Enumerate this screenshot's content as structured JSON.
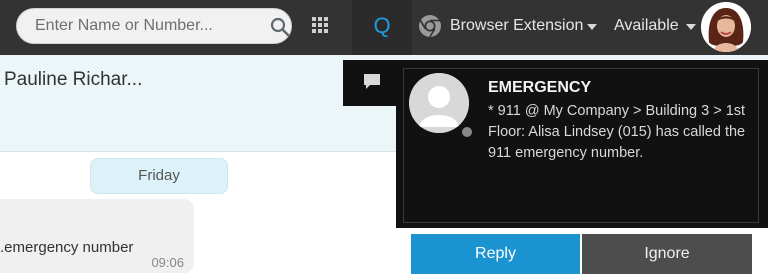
{
  "topbar": {
    "search": {
      "placeholder": "Enter Name or Number...",
      "icon": "search-icon"
    },
    "apps_icon": "grid-icon",
    "q_tab_label": "Q",
    "extension": {
      "label": "Browser Extension",
      "icon": "chrome-icon"
    },
    "status": {
      "label": "Available"
    },
    "colors": {
      "bar": "#333333",
      "accent": "#1e9be0"
    }
  },
  "chat": {
    "contact_name": "Pauline Richar...",
    "day_divider": "Friday",
    "message": {
      "text": "emergency number.",
      "time": "09:06"
    }
  },
  "notification": {
    "title": "EMERGENCY",
    "body": "* 911 @ My Company > Building 3 > 1st Floor: Alisa Lindsey (015) has called the 911 emergency number.",
    "reply_label": "Reply",
    "ignore_label": "Ignore",
    "colors": {
      "reply": "#1c93d1",
      "ignore": "#4d4d4d",
      "background": "#111111"
    }
  }
}
